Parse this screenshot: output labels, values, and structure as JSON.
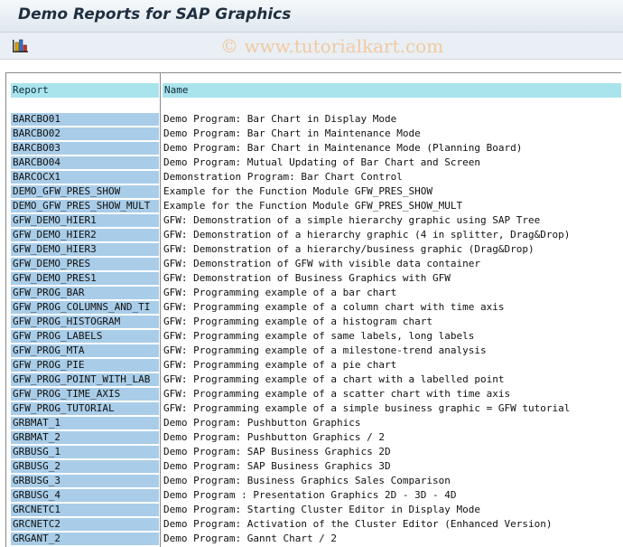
{
  "window": {
    "title": "Demo Reports for SAP Graphics"
  },
  "toolbar": {
    "buttons": [
      {
        "icon": "chart-icon"
      }
    ]
  },
  "watermark": "© www.tutorialkart.com",
  "table": {
    "columns": [
      "Report",
      "Name"
    ],
    "rows": [
      [
        "BARCBO01",
        "Demo Program: Bar Chart in Display Mode"
      ],
      [
        "BARCBO02",
        "Demo Program: Bar Chart in Maintenance Mode"
      ],
      [
        "BARCBO03",
        "Demo Program: Bar Chart in Maintenance Mode (Planning Board)"
      ],
      [
        "BARCBO04",
        "Demo Program: Mutual Updating of Bar Chart and Screen"
      ],
      [
        "BARCOCX1",
        "Demonstration Program: Bar Chart Control"
      ],
      [
        "DEMO_GFW_PRES_SHOW",
        "Example for the Function Module GFW_PRES_SHOW"
      ],
      [
        "DEMO_GFW_PRES_SHOW_MULT",
        "Example for the Function Module GFW_PRES_SHOW_MULT"
      ],
      [
        "GFW_DEMO_HIER1",
        "GFW: Demonstration of a simple hierarchy graphic using SAP Tree"
      ],
      [
        "GFW_DEMO_HIER2",
        "GFW: Demonstration of a hierarchy graphic (4 in splitter, Drag&Drop)"
      ],
      [
        "GFW_DEMO_HIER3",
        "GFW: Demonstration of a hierarchy/business graphic (Drag&Drop)"
      ],
      [
        "GFW_DEMO_PRES",
        "GFW: Demonstration of GFW with visible data container"
      ],
      [
        "GFW_DEMO_PRES1",
        "GFW: Demonstration of Business Graphics with GFW"
      ],
      [
        "GFW_PROG_BAR",
        "GFW: Programming example of a bar chart"
      ],
      [
        "GFW_PROG_COLUMNS_AND_TI",
        "GFW: Programming example of a column chart with time axis"
      ],
      [
        "GFW_PROG_HISTOGRAM",
        "GFW: Programming example of a histogram chart"
      ],
      [
        "GFW_PROG_LABELS",
        "GFW: Programming example of same labels, long labels"
      ],
      [
        "GFW_PROG_MTA",
        "GFW: Programming example of a milestone-trend analysis"
      ],
      [
        "GFW_PROG_PIE",
        "GFW: Programming example of a pie chart"
      ],
      [
        "GFW_PROG_POINT_WITH_LAB",
        "GFW: Programming example of a chart with a labelled point"
      ],
      [
        "GFW_PROG_TIME_AXIS",
        "GFW: Programming example of a scatter chart with time axis"
      ],
      [
        "GFW_PROG_TUTORIAL",
        "GFW: Programming example of a simple business graphic = GFW tutorial"
      ],
      [
        "GRBMAT_1",
        "Demo Program: Pushbutton Graphics"
      ],
      [
        "GRBMAT_2",
        "Demo Program: Pushbutton Graphics / 2"
      ],
      [
        "GRBUSG_1",
        "Demo Program: SAP Business Graphics 2D"
      ],
      [
        "GRBUSG_2",
        "Demo Program: SAP Business Graphics 3D"
      ],
      [
        "GRBUSG_3",
        "Demo Program: Business Graphics Sales Comparison"
      ],
      [
        "GRBUSG_4",
        "Demo Program : Presentation Graphics 2D - 3D - 4D"
      ],
      [
        "GRCNETC1",
        "Demo Program: Starting Cluster Editor in Display Mode"
      ],
      [
        "GRCNETC2",
        "Demo Program: Activation of the Cluster Editor (Enhanced Version)"
      ],
      [
        "GRGANT_2",
        "Demo Program: Gannt Chart / 2"
      ]
    ]
  },
  "colors": {
    "header_bg": "#a9e4ec",
    "key_cell_bg": "#a9cde8",
    "watermark": "#f1c9a0"
  }
}
